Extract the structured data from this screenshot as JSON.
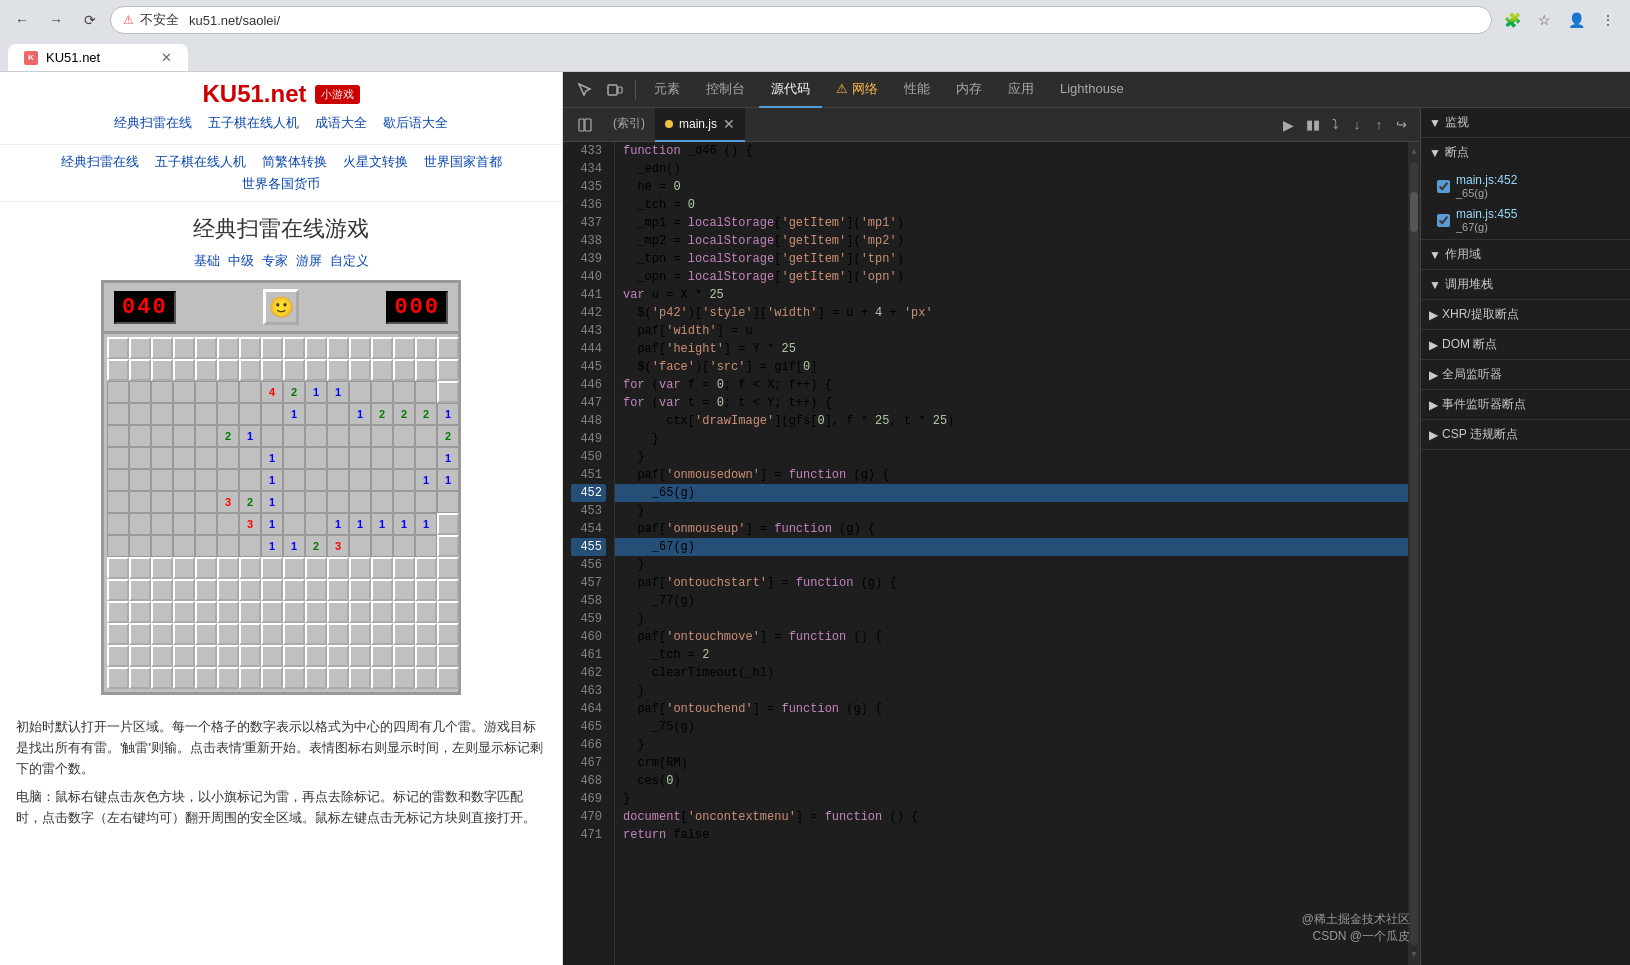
{
  "browser": {
    "url": "ku51.net/saolei/",
    "security_label": "不安全",
    "tab_title": "KU51.net"
  },
  "devtools": {
    "tabs": [
      "元素",
      "控制台",
      "源代码",
      "网络",
      "性能",
      "内存",
      "应用",
      "Lighthouse"
    ],
    "active_tab": "源代码",
    "warning_tab": "网络",
    "source_tabs": [
      "(索引)",
      "main.js"
    ],
    "active_source_tab": "main.js"
  },
  "sidebar": {
    "sections": [
      {
        "label": "监视",
        "expanded": true
      },
      {
        "label": "断点",
        "expanded": true
      },
      {
        "label": "作用域",
        "expanded": true
      },
      {
        "label": "调用堆栈",
        "expanded": true
      },
      {
        "label": "XHR/提取断点",
        "collapsed": true
      },
      {
        "label": "DOM 断点",
        "collapsed": true
      },
      {
        "label": "全局监听器",
        "collapsed": true
      },
      {
        "label": "事件监听器断点",
        "collapsed": true
      },
      {
        "label": "CSP 违规断点",
        "collapsed": true
      }
    ],
    "breakpoints": [
      {
        "file": "main.js:452",
        "func": "_65(g)",
        "checked": true
      },
      {
        "file": "main.js:455",
        "func": "_67(g)",
        "checked": true
      }
    ]
  },
  "website": {
    "logo": "KU51.net",
    "badge": "小游戏",
    "nav": [
      "经典扫雷在线",
      "五子棋在线人机",
      "成语大全",
      "歇后语大全"
    ],
    "subnav": [
      "经典扫雷在线",
      "五子棋在线人机",
      "简繁体转换",
      "火星文转换",
      "世界国家首都",
      "世界各国货币"
    ],
    "game_title": "经典扫雷在线游戏",
    "game_links": [
      "基础",
      "中级",
      "专家",
      "游屏",
      "自定义"
    ],
    "mine_counter": "040",
    "time_counter": "000",
    "desc1": "初始时默认打开一片区域。每一个格子的数字表示以格式为中心的四周有几个雷。游戏目标是找出所有有雷。'触雷'则输。点击表情'重新开始。表情图标右则显示时间，左则显示标记剩下的雷个数。",
    "desc2": "电脑：鼠标右键点击灰色方块，以小旗标记为雷，再点去除标记。标记的雷数和数字匹配时，点击数字（左右键均可）翻开周围的安全区域。鼠标左键点击无标记方块则直接打开。"
  },
  "code": {
    "lines": [
      {
        "num": 433,
        "content": "function _d46 () {",
        "highlighted": false
      },
      {
        "num": 434,
        "content": "  _edn()",
        "highlighted": false
      },
      {
        "num": 435,
        "content": "  he = 0",
        "highlighted": false
      },
      {
        "num": 436,
        "content": "  _tch = 0",
        "highlighted": false
      },
      {
        "num": 437,
        "content": "  _mp1 = localStorage['getItem']('mp1')",
        "highlighted": false
      },
      {
        "num": 438,
        "content": "  _mp2 = localStorage['getItem']('mp2')",
        "highlighted": false
      },
      {
        "num": 439,
        "content": "  _tpn = localStorage['getItem']('tpn')",
        "highlighted": false
      },
      {
        "num": 440,
        "content": "  _opn = localStorage['getItem']('opn')",
        "highlighted": false
      },
      {
        "num": 441,
        "content": "  var u = X * 25",
        "highlighted": false
      },
      {
        "num": 442,
        "content": "  $('p42')['style']['width'] = u + 4 + 'px'",
        "highlighted": false
      },
      {
        "num": 443,
        "content": "  paf['width'] = u",
        "highlighted": false
      },
      {
        "num": 444,
        "content": "  paf['height'] = Y * 25",
        "highlighted": false
      },
      {
        "num": 445,
        "content": "  $('face')['src'] = gif[0]",
        "highlighted": false
      },
      {
        "num": 446,
        "content": "  for (var f = 0; f < X; f++) {",
        "highlighted": false
      },
      {
        "num": 447,
        "content": "    for (var t = 0; t < Y; t++) {",
        "highlighted": false
      },
      {
        "num": 448,
        "content": "      ctx['drawImage'](gfs[0], f * 25, t * 25)",
        "highlighted": false
      },
      {
        "num": 449,
        "content": "    }",
        "highlighted": false
      },
      {
        "num": 450,
        "content": "  }",
        "highlighted": false
      },
      {
        "num": 451,
        "content": "  paf['onmousedown'] = function (g) {",
        "highlighted": false
      },
      {
        "num": 452,
        "content": "    _65(g)",
        "highlighted": true
      },
      {
        "num": 453,
        "content": "  }",
        "highlighted": false
      },
      {
        "num": 454,
        "content": "  paf['onmouseup'] = function (g) {",
        "highlighted": false
      },
      {
        "num": 455,
        "content": "    _67(g)",
        "highlighted": true
      },
      {
        "num": 456,
        "content": "  }",
        "highlighted": false
      },
      {
        "num": 457,
        "content": "  paf['ontouchstart'] = function (g) {",
        "highlighted": false
      },
      {
        "num": 458,
        "content": "    _77(g)",
        "highlighted": false
      },
      {
        "num": 459,
        "content": "  }",
        "highlighted": false
      },
      {
        "num": 460,
        "content": "  paf['ontouchmove'] = function () {",
        "highlighted": false
      },
      {
        "num": 461,
        "content": "    _tch = 2",
        "highlighted": false
      },
      {
        "num": 462,
        "content": "    clearTimeout(_hl)",
        "highlighted": false
      },
      {
        "num": 463,
        "content": "  }",
        "highlighted": false
      },
      {
        "num": 464,
        "content": "  paf['ontouchend'] = function (g) {",
        "highlighted": false
      },
      {
        "num": 465,
        "content": "    _75(g)",
        "highlighted": false
      },
      {
        "num": 466,
        "content": "  }",
        "highlighted": false
      },
      {
        "num": 467,
        "content": "  crm(RM)",
        "highlighted": false
      },
      {
        "num": 468,
        "content": "  ces(0)",
        "highlighted": false
      },
      {
        "num": 469,
        "content": "}",
        "highlighted": false
      },
      {
        "num": 470,
        "content": "document['oncontextmenu'] = function () {",
        "highlighted": false
      },
      {
        "num": 471,
        "content": "  return false",
        "highlighted": false
      }
    ]
  },
  "watermark": {
    "line1": "@稀土掘金技术社区",
    "line2": "CSDN @一个瓜皮"
  }
}
